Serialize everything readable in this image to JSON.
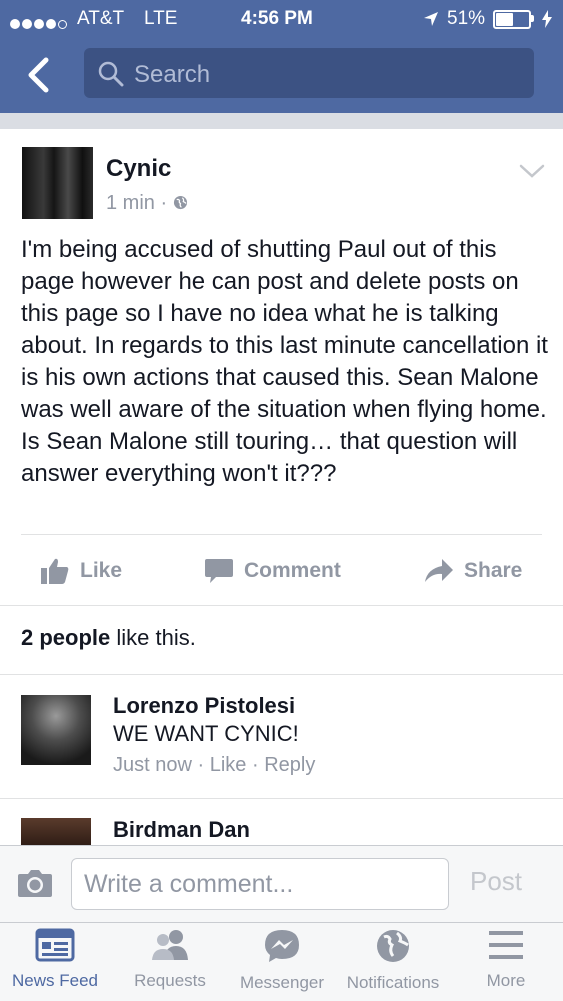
{
  "status_bar": {
    "carrier": "AT&T",
    "network": "LTE",
    "time": "4:56 PM",
    "battery": "51%",
    "battery_level": 0.51
  },
  "nav": {
    "back_icon": "chevron-left-icon",
    "search_placeholder": "Search"
  },
  "post": {
    "author": "Cynic",
    "time": "1 min",
    "privacy_icon": "globe-icon",
    "text": "I'm being accused of shutting Paul out of this page however he can post and delete posts on this page so I have no idea what he is talking about. In regards to this last minute cancellation it is his own actions that caused this. Sean Malone was well aware of the situation when flying home. Is Sean Malone still touring… that question will answer everything won't it???",
    "actions": {
      "like": "Like",
      "comment": "Comment",
      "share": "Share"
    },
    "likes_count": "2 people",
    "likes_suffix": " like this."
  },
  "comments": [
    {
      "name": "Lorenzo Pistolesi",
      "text": "WE WANT CYNIC!",
      "time": "Just now",
      "like": "Like",
      "reply": "Reply"
    },
    {
      "name": "Birdman Dan"
    }
  ],
  "composer": {
    "placeholder": "Write a comment...",
    "post_label": "Post"
  },
  "tabs": [
    {
      "label": "News Feed",
      "icon": "news-feed-icon",
      "active": true
    },
    {
      "label": "Requests",
      "icon": "friends-icon",
      "active": false
    },
    {
      "label": "Messenger",
      "icon": "messenger-icon",
      "active": false
    },
    {
      "label": "Notifications",
      "icon": "globe-icon",
      "active": false
    },
    {
      "label": "More",
      "icon": "menu-icon",
      "active": false
    }
  ],
  "colors": {
    "brand": "#4e69a2",
    "muted": "#9197a3",
    "text": "#141823"
  }
}
